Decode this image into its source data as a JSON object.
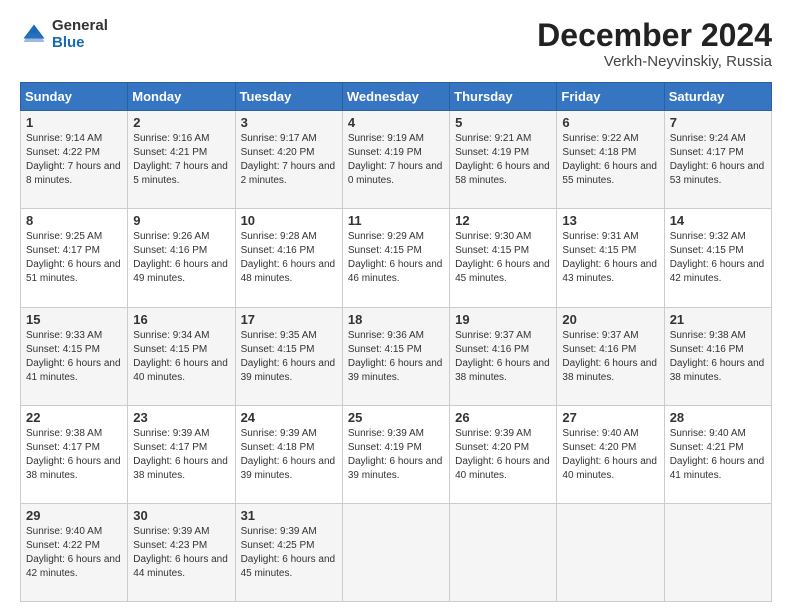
{
  "logo": {
    "general": "General",
    "blue": "Blue"
  },
  "title": "December 2024",
  "location": "Verkh-Neyvinskiy, Russia",
  "days_header": [
    "Sunday",
    "Monday",
    "Tuesday",
    "Wednesday",
    "Thursday",
    "Friday",
    "Saturday"
  ],
  "weeks": [
    [
      {
        "day": "1",
        "sunrise": "9:14 AM",
        "sunset": "4:22 PM",
        "daylight": "7 hours and 8 minutes."
      },
      {
        "day": "2",
        "sunrise": "9:16 AM",
        "sunset": "4:21 PM",
        "daylight": "7 hours and 5 minutes."
      },
      {
        "day": "3",
        "sunrise": "9:17 AM",
        "sunset": "4:20 PM",
        "daylight": "7 hours and 2 minutes."
      },
      {
        "day": "4",
        "sunrise": "9:19 AM",
        "sunset": "4:19 PM",
        "daylight": "7 hours and 0 minutes."
      },
      {
        "day": "5",
        "sunrise": "9:21 AM",
        "sunset": "4:19 PM",
        "daylight": "6 hours and 58 minutes."
      },
      {
        "day": "6",
        "sunrise": "9:22 AM",
        "sunset": "4:18 PM",
        "daylight": "6 hours and 55 minutes."
      },
      {
        "day": "7",
        "sunrise": "9:24 AM",
        "sunset": "4:17 PM",
        "daylight": "6 hours and 53 minutes."
      }
    ],
    [
      {
        "day": "8",
        "sunrise": "9:25 AM",
        "sunset": "4:17 PM",
        "daylight": "6 hours and 51 minutes."
      },
      {
        "day": "9",
        "sunrise": "9:26 AM",
        "sunset": "4:16 PM",
        "daylight": "6 hours and 49 minutes."
      },
      {
        "day": "10",
        "sunrise": "9:28 AM",
        "sunset": "4:16 PM",
        "daylight": "6 hours and 48 minutes."
      },
      {
        "day": "11",
        "sunrise": "9:29 AM",
        "sunset": "4:15 PM",
        "daylight": "6 hours and 46 minutes."
      },
      {
        "day": "12",
        "sunrise": "9:30 AM",
        "sunset": "4:15 PM",
        "daylight": "6 hours and 45 minutes."
      },
      {
        "day": "13",
        "sunrise": "9:31 AM",
        "sunset": "4:15 PM",
        "daylight": "6 hours and 43 minutes."
      },
      {
        "day": "14",
        "sunrise": "9:32 AM",
        "sunset": "4:15 PM",
        "daylight": "6 hours and 42 minutes."
      }
    ],
    [
      {
        "day": "15",
        "sunrise": "9:33 AM",
        "sunset": "4:15 PM",
        "daylight": "6 hours and 41 minutes."
      },
      {
        "day": "16",
        "sunrise": "9:34 AM",
        "sunset": "4:15 PM",
        "daylight": "6 hours and 40 minutes."
      },
      {
        "day": "17",
        "sunrise": "9:35 AM",
        "sunset": "4:15 PM",
        "daylight": "6 hours and 39 minutes."
      },
      {
        "day": "18",
        "sunrise": "9:36 AM",
        "sunset": "4:15 PM",
        "daylight": "6 hours and 39 minutes."
      },
      {
        "day": "19",
        "sunrise": "9:37 AM",
        "sunset": "4:16 PM",
        "daylight": "6 hours and 38 minutes."
      },
      {
        "day": "20",
        "sunrise": "9:37 AM",
        "sunset": "4:16 PM",
        "daylight": "6 hours and 38 minutes."
      },
      {
        "day": "21",
        "sunrise": "9:38 AM",
        "sunset": "4:16 PM",
        "daylight": "6 hours and 38 minutes."
      }
    ],
    [
      {
        "day": "22",
        "sunrise": "9:38 AM",
        "sunset": "4:17 PM",
        "daylight": "6 hours and 38 minutes."
      },
      {
        "day": "23",
        "sunrise": "9:39 AM",
        "sunset": "4:17 PM",
        "daylight": "6 hours and 38 minutes."
      },
      {
        "day": "24",
        "sunrise": "9:39 AM",
        "sunset": "4:18 PM",
        "daylight": "6 hours and 39 minutes."
      },
      {
        "day": "25",
        "sunrise": "9:39 AM",
        "sunset": "4:19 PM",
        "daylight": "6 hours and 39 minutes."
      },
      {
        "day": "26",
        "sunrise": "9:39 AM",
        "sunset": "4:20 PM",
        "daylight": "6 hours and 40 minutes."
      },
      {
        "day": "27",
        "sunrise": "9:40 AM",
        "sunset": "4:20 PM",
        "daylight": "6 hours and 40 minutes."
      },
      {
        "day": "28",
        "sunrise": "9:40 AM",
        "sunset": "4:21 PM",
        "daylight": "6 hours and 41 minutes."
      }
    ],
    [
      {
        "day": "29",
        "sunrise": "9:40 AM",
        "sunset": "4:22 PM",
        "daylight": "6 hours and 42 minutes."
      },
      {
        "day": "30",
        "sunrise": "9:39 AM",
        "sunset": "4:23 PM",
        "daylight": "6 hours and 44 minutes."
      },
      {
        "day": "31",
        "sunrise": "9:39 AM",
        "sunset": "4:25 PM",
        "daylight": "6 hours and 45 minutes."
      },
      null,
      null,
      null,
      null
    ]
  ],
  "labels": {
    "sunrise": "Sunrise:",
    "sunset": "Sunset:",
    "daylight": "Daylight:"
  }
}
